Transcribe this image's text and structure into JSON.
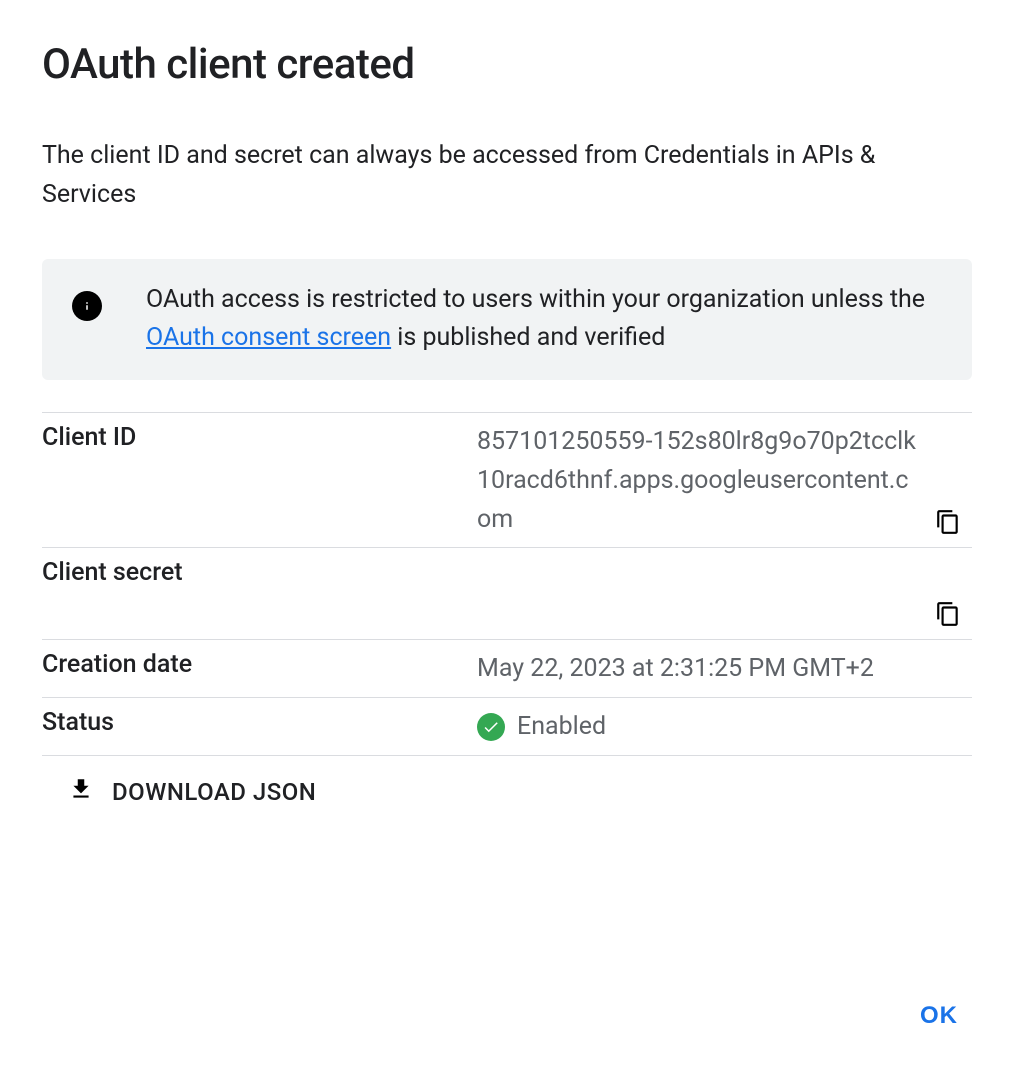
{
  "title": "OAuth client created",
  "subtitle": "The client ID and secret can always be accessed from Credentials in APIs & Services",
  "info_box": {
    "text_before": "OAuth access is restricted to users within your organization unless the ",
    "link_text": "OAuth consent screen",
    "text_after": " is published and verified"
  },
  "rows": {
    "client_id": {
      "label": "Client ID",
      "value": "857101250559-152s80lr8g9o70p2tcclk10racd6thnf.apps.googleusercontent.com"
    },
    "client_secret": {
      "label": "Client secret",
      "value": ""
    },
    "creation_date": {
      "label": "Creation date",
      "value": "May 22, 2023 at 2:31:25 PM GMT+2"
    },
    "status": {
      "label": "Status",
      "value": "Enabled"
    }
  },
  "download_label": "DOWNLOAD JSON",
  "ok_label": "OK"
}
